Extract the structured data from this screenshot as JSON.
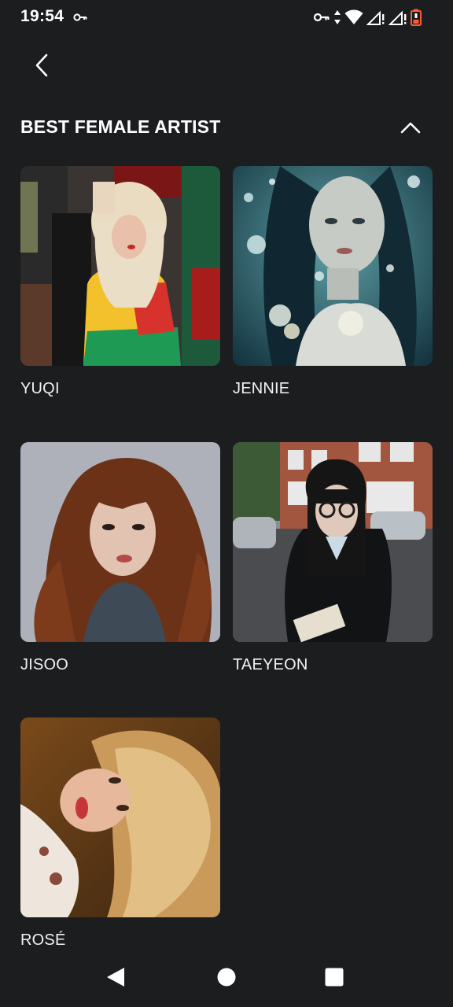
{
  "status_bar": {
    "time": "19:54",
    "icons": [
      "vpn-key-icon",
      "data-arrows-icon",
      "wifi-icon",
      "signal-icon",
      "signal-icon",
      "battery-low-icon"
    ]
  },
  "header": {
    "back_icon": "chevron-left-icon"
  },
  "section": {
    "title": "BEST FEMALE ARTIST",
    "collapse_icon": "chevron-up-icon",
    "artists": [
      {
        "name": "YUQI"
      },
      {
        "name": "JENNIE"
      },
      {
        "name": "JISOO"
      },
      {
        "name": "TAEYEON"
      },
      {
        "name": "ROSÉ"
      }
    ]
  },
  "nav_bar": {
    "back_icon": "triangle-back-icon",
    "home_icon": "circle-home-icon",
    "recents_icon": "square-recents-icon"
  },
  "colors": {
    "background": "#1c1d1f",
    "text": "#ffffff",
    "battery_low": "#ff5a36"
  }
}
